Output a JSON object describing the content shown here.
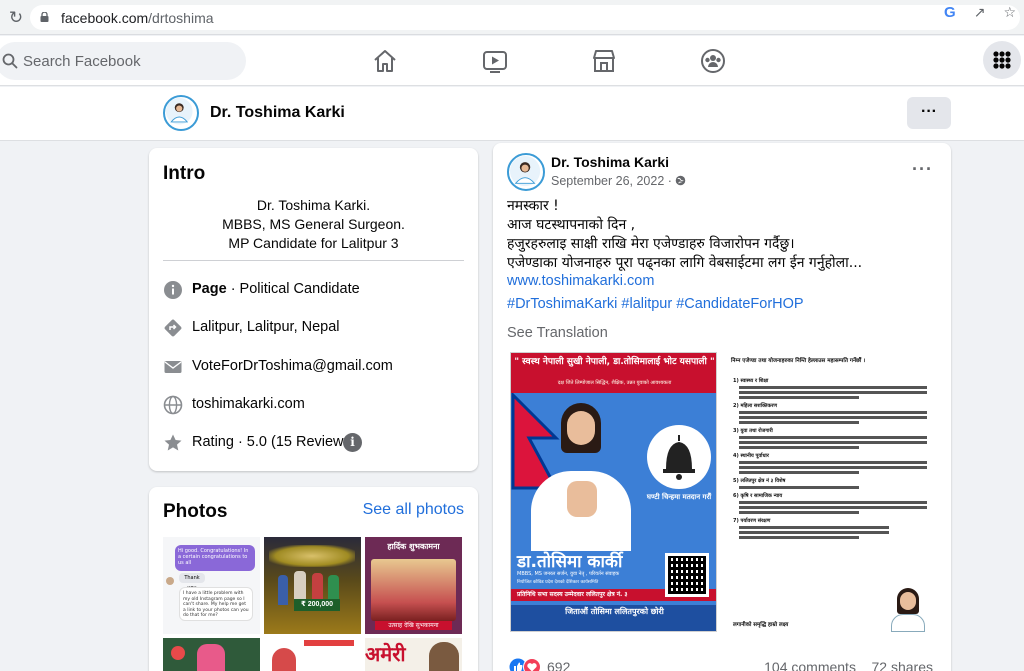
{
  "browser": {
    "url_host": "facebook.com",
    "url_path": "/drtoshima"
  },
  "nav": {
    "search_placeholder": "Search Facebook",
    "icons": [
      "home-icon",
      "watch-icon",
      "marketplace-icon",
      "groups-icon",
      "apps-grid-icon"
    ]
  },
  "page_header": {
    "name": "Dr. Toshima Karki"
  },
  "intro": {
    "title": "Intro",
    "bio": [
      "Dr. Toshima Karki.",
      "MBBS, MS General Surgeon.",
      "MP Candidate for Lalitpur 3"
    ],
    "page_label": "Page",
    "category": " · Political Candidate",
    "location": "Lalitpur, Lalitpur, Nepal",
    "email": "VoteForDrToshima@gmail.com",
    "website": "toshimakarki.com",
    "rating": "Rating · 5.0 (15 Reviews)"
  },
  "photos": {
    "title": "Photos",
    "see_all": "See all photos",
    "thumb_texts": {
      "chat_message": "Hi good. Congratulations! In a certain congratulations to us all",
      "thank_you": "Thank you",
      "chat_reply": "I have a little problem with my old Instagram page so I can't share. My help me get a link to your photos can you do that for me?",
      "price_tag": "₹ 200,000",
      "congrats_title": "हार्दिक शुभकामना",
      "banner_caption": "उत्साह देखि सुभकामना",
      "bottom_banner": "अमेरी"
    }
  },
  "post": {
    "author": "Dr. Toshima Karki",
    "date": "September 26, 2022 · ",
    "lines": [
      "नमस्कार !",
      "आज घटस्थापनाको दिन ,",
      "हजुरहरुलाइ साक्षी राखि मेरा एजेण्डाहरु विजारोपन गर्दैछु।",
      "एजेण्डाका योजनाहरु पूरा पढ्नका लागि वेबसाईटमा लग ईन गर्नुहोला..."
    ],
    "link": "www.toshimakarki.com",
    "tags": "#DrToshimaKarki #lalitpur #CandidateForHOP",
    "see_translation": "See Translation",
    "poster": {
      "slogan": "\" स्वस्थ नेपाली सुखी नेपाली, डा.तोसिमालाई भोट यसपाली \"",
      "subtitle": "दक्ष जिते लिम्पोजाल सिद्धिन, शैक्षिक, उन्नत युवाको आवश्यकता",
      "symbol_text": "घण्टी चिन्हमा मतदान गरौं",
      "name": "डा.तोसिमा कार्की",
      "credentials": "MBBS, MS जनरल सर्जन, युवा नेतृ , परिवर्तन संवाहक",
      "position": "नियोजित कोविड प्रदेश देशको देशिकार कार्यसमिति",
      "candidacy": "प्रतिनिधि सभा सदस्य उम्मेदवार  ललितपुर क्षेत्र नं. ३",
      "footer": "जिताऔं तोसिमा ललितपुरको छोरी"
    },
    "doc": {
      "heading": "निम्न एजेण्डा तथा योजनाहरुका निम्ति हेल्लाउस महासम्पति गर्नेछौं ।",
      "sections": [
        "स्वास्थ्य र शिक्षा",
        "महिला सशक्तिकरण",
        "युवा तथा रोजगारी",
        "स्थानीय पूर्वाधार",
        "ललितपुर क्षेत्र नं ३ विशेष",
        "कृषि र सामाजिक न्याय",
        "पर्यावरण संरक्षण"
      ],
      "footer": "लगानीको समृद्धि हाम्रो लक्ष्य"
    },
    "reactions_count": "692",
    "comments": "104 comments",
    "shares": "72 shares"
  }
}
